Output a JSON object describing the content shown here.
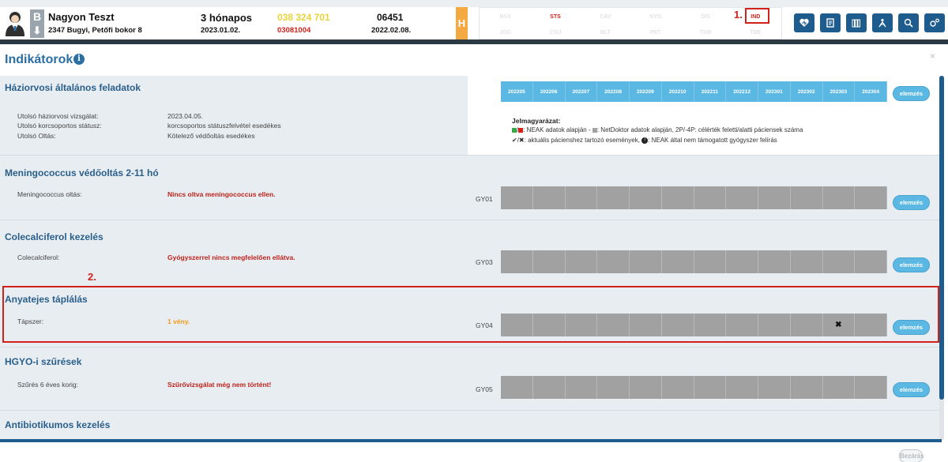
{
  "patient": {
    "type_letter": "B",
    "type_arrow": "⬇",
    "name": "Nagyon Teszt",
    "address": "2347 Bugyi, Petőfi bokor 8",
    "age": "3 hónapos",
    "birth_date": "2023.01.02.",
    "phone": "038 324 701",
    "taj": "03081004",
    "code": "06451",
    "code_date": "2022.02.08.",
    "badge": "H"
  },
  "status_tabs": [
    "NSY",
    "STS",
    "CAV",
    "NYO",
    "DIS",
    "IND",
    "JOG",
    "CSU",
    "BLT",
    "PET",
    "TSW",
    "TBE"
  ],
  "status_active": [
    "STS",
    "IND"
  ],
  "markers": {
    "one": "1.",
    "two": "2."
  },
  "toolbar_icons": [
    "heart-icon",
    "document-icon",
    "books-icon",
    "playground-icon",
    "search-zoom-icon",
    "settings-icon"
  ],
  "modal": {
    "title": "Indikátorok",
    "info_icon": "i",
    "close_icon": "×",
    "close_button": "Bezárás"
  },
  "months": [
    "202205",
    "202206",
    "202207",
    "202208",
    "202209",
    "202210",
    "202211",
    "202212",
    "202301",
    "202302",
    "202303",
    "202304"
  ],
  "legend": {
    "title": "Jelmagyarázat:",
    "line1": ": NEAK adatok alapján - ",
    "line1b": ": NetDoktor adatok alapján, 2P/-4P: célérték feletti/alatti páciensek száma",
    "line2": "✔/✖: aktuális pácienshez tartozó események, ",
    "line2b": ": NEAK által nem támogatott gyógyszer felírás",
    "slash": "/"
  },
  "sections": {
    "general": {
      "title": "Háziorvosi általános feladatok",
      "rows": [
        {
          "label": "Utolsó háziorvosi vizsgálat:",
          "value": "2023.04.05."
        },
        {
          "label": "Utolsó korcsoportos státusz:",
          "value": "korcsoportos státuszfelvétel esedékes"
        },
        {
          "label": "Utolsó Oltás:",
          "value": "Kötelező védőoltás esedékes"
        }
      ]
    },
    "meningo": {
      "title": "Meningococcus védőoltás 2-11 hó",
      "label": "Meningococcus oltás:",
      "value": "Nincs oltva meningococcus ellen.",
      "code": "GY01"
    },
    "coleca": {
      "title": "Colecalciferol kezelés",
      "label": "Colecalciferol:",
      "value": "Gyógyszerrel nincs megfelelően ellátva.",
      "code": "GY03"
    },
    "anyatej": {
      "title": "Anyatejes táplálás",
      "label": "Tápszer:",
      "value": "1 vény.",
      "code": "GY04",
      "marked_month": "202303",
      "mark": "✖"
    },
    "hgyo": {
      "title": "HGYO-i szűrések",
      "label": "Szűrés 6 éves korig:",
      "value": "Szűrővizsgálat még nem történt!",
      "code": "GY05"
    },
    "antibio": {
      "title": "Antibiotikumos kezelés"
    }
  },
  "elemzes_label": "elemzés",
  "colors": {
    "accent": "#2a6fa3",
    "month_header": "#5bb8e3",
    "cell": "#a1a1a1",
    "red": "#c0221b",
    "orange": "#f09a18",
    "highlight": "#d0221b"
  }
}
